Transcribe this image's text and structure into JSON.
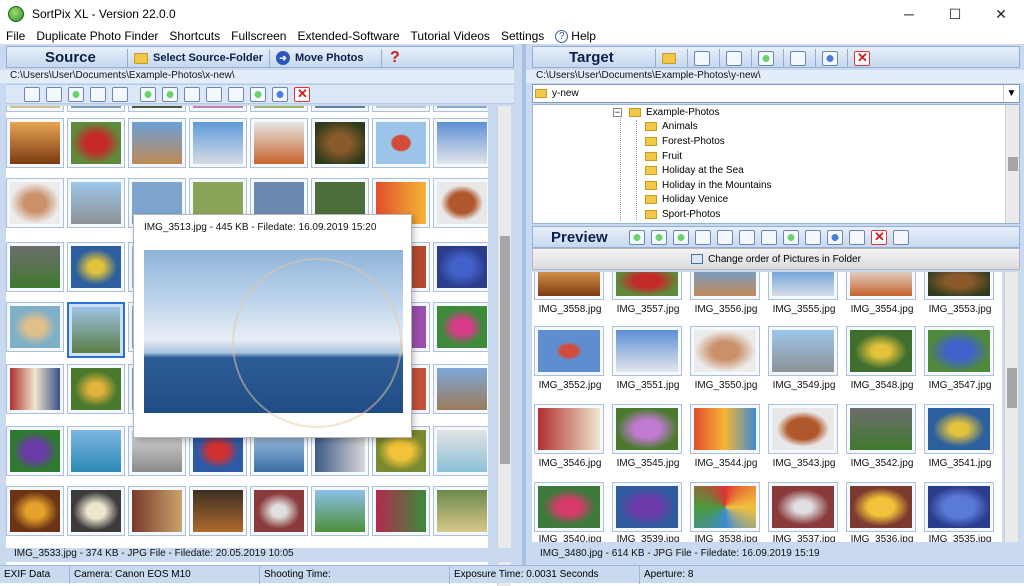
{
  "app": {
    "title": "SortPix XL - Version 22.0.0"
  },
  "window_controls": {
    "minimize": "─",
    "maximize": "☐",
    "close": "✕"
  },
  "menu": [
    "File",
    "Duplicate Photo Finder",
    "Shortcuts",
    "Fullscreen",
    "Extended-Software",
    "Tutorial Videos",
    "Settings",
    "Help"
  ],
  "source": {
    "label": "Source",
    "select_folder": "Select Source-Folder",
    "move_photos": "Move Photos",
    "help": "?",
    "path": "C:\\Users\\User\\Documents\\Example-Photos\\x-new\\",
    "status": "IMG_3533.jpg - 374 KB - JPG File - Filedate: 20.05.2019 10:05"
  },
  "popup": {
    "title": "IMG_3513.jpg - 445 KB - Filedate: 16.09.2019 15:20"
  },
  "target": {
    "label": "Target",
    "path": "C:\\Users\\User\\Documents\\Example-Photos\\y-new\\",
    "combo_value": "y-new",
    "tree": {
      "root": "Example-Photos",
      "children": [
        "Animals",
        "Forest-Photos",
        "Fruit",
        "Holiday at the Sea",
        "Holiday in the Mountains",
        "Holiday Venice",
        "Sport-Photos"
      ]
    }
  },
  "preview": {
    "label": "Preview",
    "change_order": "Change order of Pictures in Folder",
    "files": [
      "IMG_3558.jpg",
      "IMG_3557.jpg",
      "IMG_3556.jpg",
      "IMG_3555.jpg",
      "IMG_3554.jpg",
      "IMG_3553.jpg",
      "IMG_3552.jpg",
      "IMG_3551.jpg",
      "IMG_3550.jpg",
      "IMG_3549.jpg",
      "IMG_3548.jpg",
      "IMG_3547.jpg",
      "IMG_3546.jpg",
      "IMG_3545.jpg",
      "IMG_3544.jpg",
      "IMG_3543.jpg",
      "IMG_3542.jpg",
      "IMG_3541.jpg",
      "IMG_3540.jpg",
      "IMG_3539.jpg",
      "IMG_3538.jpg",
      "IMG_3537.jpg",
      "IMG_3536.jpg",
      "IMG_3535.jpg"
    ],
    "status": "IMG_3480.jpg - 614 KB - JPG File - Filedate: 16.09.2019 15:19"
  },
  "statusbar": {
    "exif": "EXIF Data",
    "camera": "Camera: Canon EOS M10",
    "shooting": "Shooting Time:",
    "exposure": "Exposure Time: 0.0031 Seconds",
    "aperture": "Aperture: 8"
  },
  "colors": {
    "accent": "#2c6fd6",
    "pane_bg": "#c8d9f0",
    "close_red": "#d21d1d"
  }
}
